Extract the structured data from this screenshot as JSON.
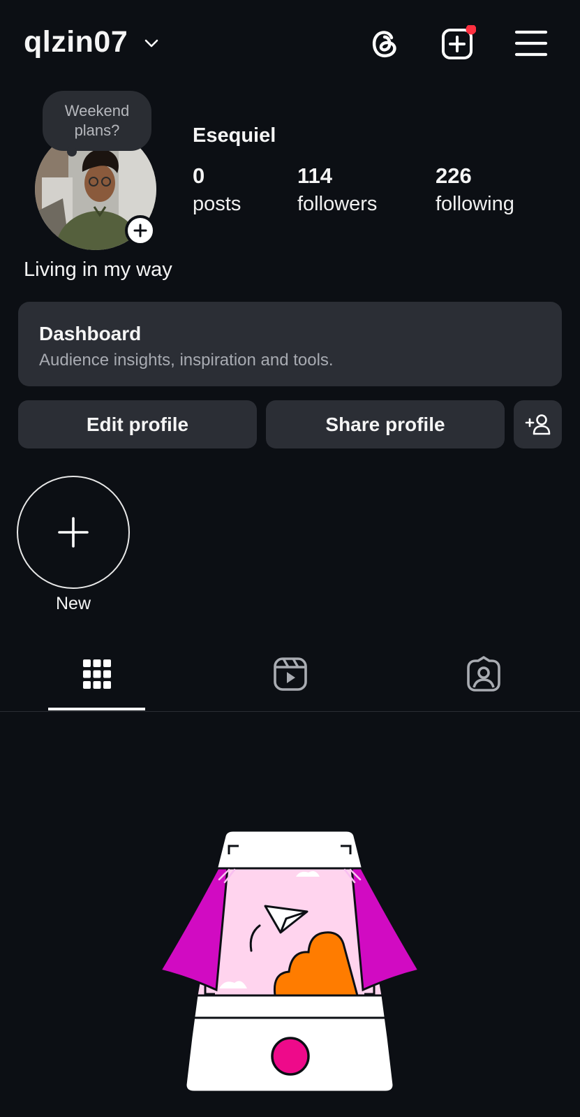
{
  "header": {
    "username": "qlzin07",
    "icons": [
      "chevron-down-icon",
      "threads-icon",
      "create-post-icon",
      "menu-icon"
    ],
    "notification_color": "#ff3040"
  },
  "profile": {
    "note": "Weekend\nplans?",
    "name": "Esequiel",
    "bio": "Living in my way",
    "stats": [
      {
        "value": "0",
        "label": "posts"
      },
      {
        "value": "114",
        "label": "followers"
      },
      {
        "value": "226",
        "label": "following"
      }
    ]
  },
  "dashboard": {
    "title": "Dashboard",
    "subtitle": "Audience insights, inspiration and tools."
  },
  "actions": {
    "edit": "Edit profile",
    "share": "Share profile",
    "discover_icon": "add-person-icon"
  },
  "highlights": {
    "new_label": "New"
  },
  "tabs": [
    "grid-icon",
    "reels-icon",
    "tagged-icon"
  ],
  "colors": {
    "background": "#0c0f14",
    "card": "#2b2e35",
    "magenta": "#d10bc2",
    "orange": "#ff7c00",
    "pink": "#ffd4ee",
    "record": "#ee0a8a"
  }
}
